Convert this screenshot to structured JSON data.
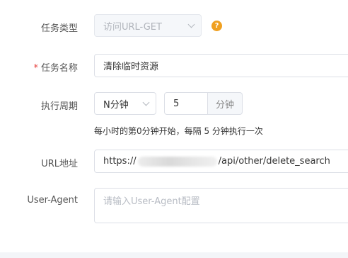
{
  "form": {
    "task_type": {
      "label": "任务类型",
      "value": "访问URL-GET",
      "help_icon": "question-circle-icon"
    },
    "task_name": {
      "required_mark": "*",
      "label": "任务名称",
      "value": "清除临时资源"
    },
    "period": {
      "label": "执行周期",
      "unit_select": "N分钟",
      "number": "5",
      "number_suffix": "分钟",
      "hint": "每小时的第0分钟开始，每隔 5 分钟执行一次"
    },
    "url": {
      "label": "URL地址",
      "value_start": "https://",
      "value_end": "/api/other/delete_search"
    },
    "user_agent": {
      "label": "User-Agent",
      "placeholder": "请输入User-Agent配置"
    }
  },
  "colors": {
    "required": "#e64340",
    "help_icon": "#f0a020",
    "border": "#dcdfe6",
    "disabled_bg": "#f5f7fa"
  }
}
